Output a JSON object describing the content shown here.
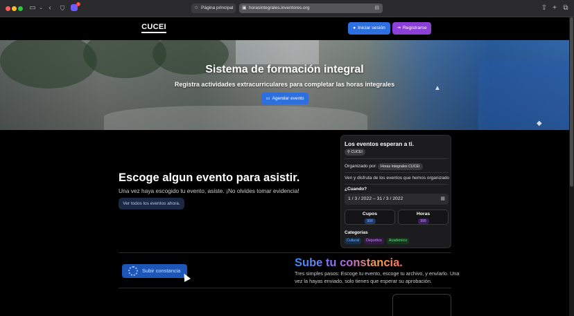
{
  "browser": {
    "tabs": [
      {
        "label": "Página principal",
        "active": false,
        "icon": "star-icon"
      },
      {
        "label": "horasintegrales.inventores.org",
        "active": true,
        "icon": "site-icon"
      }
    ],
    "extension_badge_count": "1"
  },
  "header": {
    "logo": "CUCEI",
    "login_label": "Iniciar sesión",
    "register_label": "Registrarse"
  },
  "hero": {
    "title": "Sistema de formación integral",
    "subtitle": "Registra actividades extracurriculares para completar las horas integrales",
    "schedule_label": "Agendar evento"
  },
  "main": {
    "title": "Escoge algun evento para asistir.",
    "subtitle": "Una vez haya escogido tu evento, asiste. ¡No olvides tomar evidencia!",
    "all_events_label": "Ver todos los eventos ahora."
  },
  "event_card": {
    "title": "Los eventos esperan a ti.",
    "location": "CUCEI",
    "organizer_label": "Organizado por:",
    "organizer": "Horas integrales CUCEI",
    "description": "Ven y disfruta de los eventos que hemos organizado",
    "when_label": "¿Cuando?",
    "date_range": "1 / 3 / 2022  –  31 / 3 / 2022",
    "cupos_label": "Cupos",
    "cupos_value": "999",
    "horas_label": "Horas",
    "horas_value": "999",
    "categories_label": "Categorias",
    "categories": [
      "Cultural",
      "Deportivo",
      "Academico"
    ]
  },
  "upload": {
    "button_label": "Subir constancia",
    "heading": "Sube tu constancia.",
    "description": "Tres simples pasos: Escoge tu evento, escoge tu archivo, y envíarlo. Una vez la hayas enviado, solo tienes que esperar su aprobación."
  },
  "colors": {
    "primary": "#2e6fe0",
    "register": "#8b3fd6",
    "background": "#000000"
  }
}
